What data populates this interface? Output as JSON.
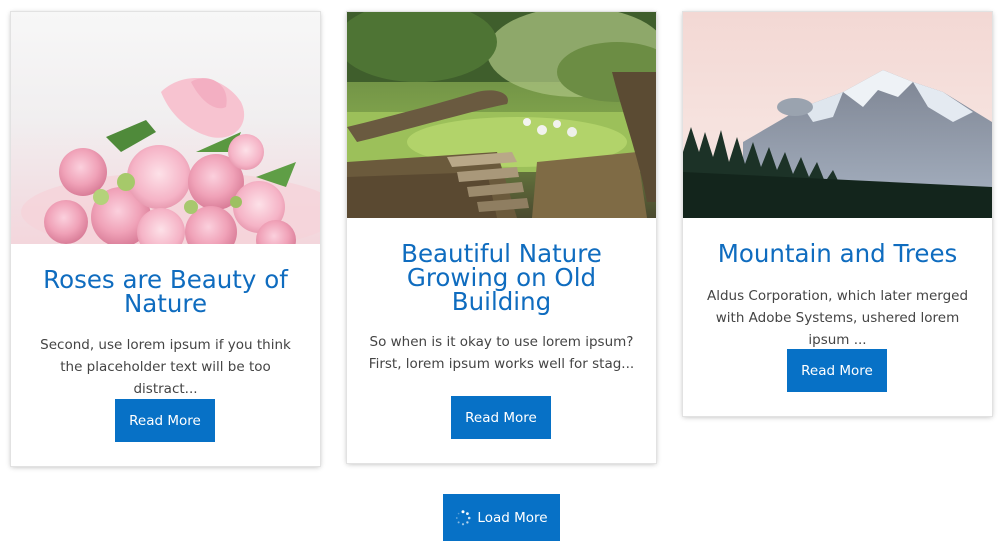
{
  "cards": [
    {
      "title": "Roses are Beauty of Nature",
      "excerpt": "Second, use lorem ipsum if you think the placeholder text will be too distract...",
      "button_label": "Read More"
    },
    {
      "title": "Beautiful Nature Growing on Old Building",
      "excerpt": "So when is it okay to use lorem ipsum? First, lorem ipsum works well for stag...",
      "button_label": "Read More"
    },
    {
      "title": "Mountain and Trees",
      "excerpt": "Aldus Corporation, which later merged with Adobe Systems, ushered lorem ipsum ...",
      "button_label": "Read More"
    }
  ],
  "load_more": {
    "label": "Load More",
    "icon": "spinner-icon"
  },
  "colors": {
    "accent": "#0771c6",
    "title": "#0f6cbf",
    "text": "#444444"
  }
}
